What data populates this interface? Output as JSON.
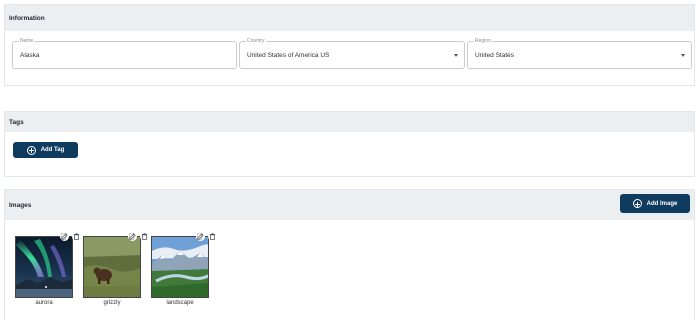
{
  "information": {
    "title": "Information",
    "name": {
      "label": "Name",
      "value": "Alaska"
    },
    "country": {
      "label": "Country",
      "value": "United States of America US"
    },
    "region": {
      "label": "Region",
      "value": "United States"
    }
  },
  "tags": {
    "title": "Tags",
    "add_label": "Add Tag"
  },
  "images": {
    "title": "Images",
    "add_label": "Add Image",
    "items": [
      {
        "caption": "aurora"
      },
      {
        "caption": "grizzly"
      },
      {
        "caption": "landscape"
      }
    ]
  },
  "colors": {
    "accent": "#0f3b5f",
    "header_bg": "#eceff2"
  }
}
